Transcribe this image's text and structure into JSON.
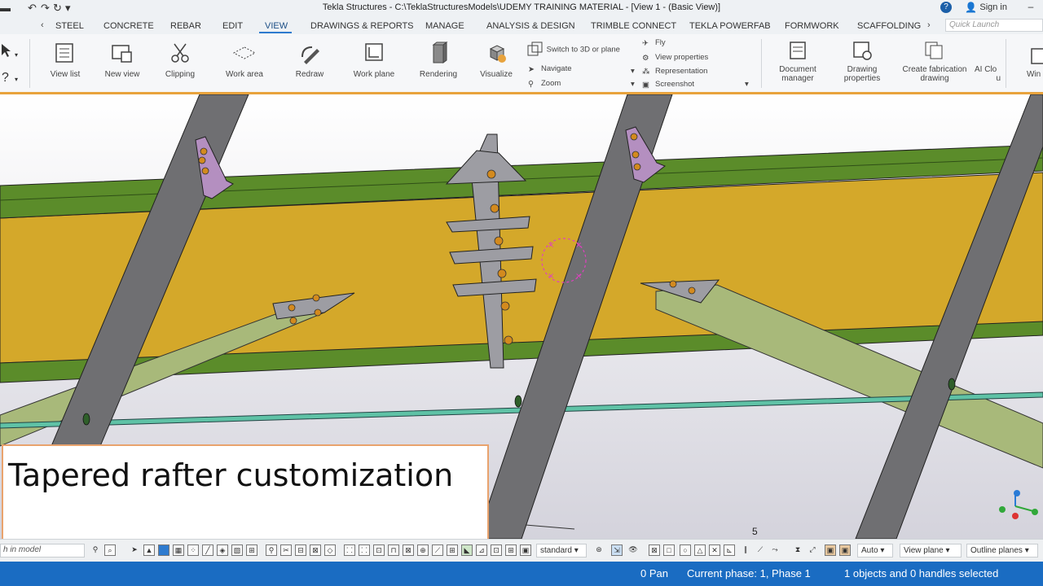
{
  "window": {
    "title": "Tekla Structures - C:\\TeklaStructuresModels\\UDEMY TRAINING MATERIAL  - [View 1 - (Basic View)]",
    "sign_in": "Sign in",
    "help": "?"
  },
  "tabs": [
    "STEEL",
    "CONCRETE",
    "REBAR",
    "EDIT",
    "VIEW",
    "DRAWINGS & REPORTS",
    "MANAGE",
    "ANALYSIS & DESIGN",
    "TRIMBLE CONNECT",
    "TEKLA POWERFAB",
    "FORMWORK",
    "SCAFFOLDING"
  ],
  "active_tab": "VIEW",
  "quick_launch_placeholder": "Quick Launch",
  "ribbon": {
    "view_list": "View list",
    "new_view": "New view",
    "clipping": "Clipping",
    "work_area": "Work area",
    "redraw": "Redraw",
    "work_plane": "Work plane",
    "rendering": "Rendering",
    "visualize": "Visualize",
    "switch_3d": "Switch to 3D or plane",
    "navigate": "Navigate",
    "zoom": "Zoom",
    "fly": "Fly",
    "view_properties": "View properties",
    "representation": "Representation",
    "screenshot": "Screenshot",
    "document_manager_1": "Document",
    "document_manager_2": "manager",
    "drawing_properties_1": "Drawing",
    "drawing_properties_2": "properties",
    "create_fab_1": "Create fabrication",
    "create_fab_2": "drawing",
    "ai_clo_1": "AI Clo",
    "ai_clo_2": "u",
    "win": "Win"
  },
  "viewport": {
    "grid_label": "5"
  },
  "caption": "Tapered rafter customization",
  "bottom": {
    "search_placeholder": "h in model",
    "standard": "standard",
    "auto": "Auto",
    "view_plane": "View plane",
    "outline_planes": "Outline planes"
  },
  "status": {
    "pan": "0  Pan",
    "phase": "Current phase: 1, Phase 1",
    "selection": "1 objects and 0 handles selected"
  },
  "colors": {
    "accent_orange": "#e8a33d",
    "status_blue": "#1a6cc2",
    "beam_yellow": "#d4a82a",
    "flange_green": "#5b8c2a",
    "rafter_grey": "#6f6f72",
    "brace_green": "#a8b97a",
    "plate_purple": "#b48fc0"
  }
}
